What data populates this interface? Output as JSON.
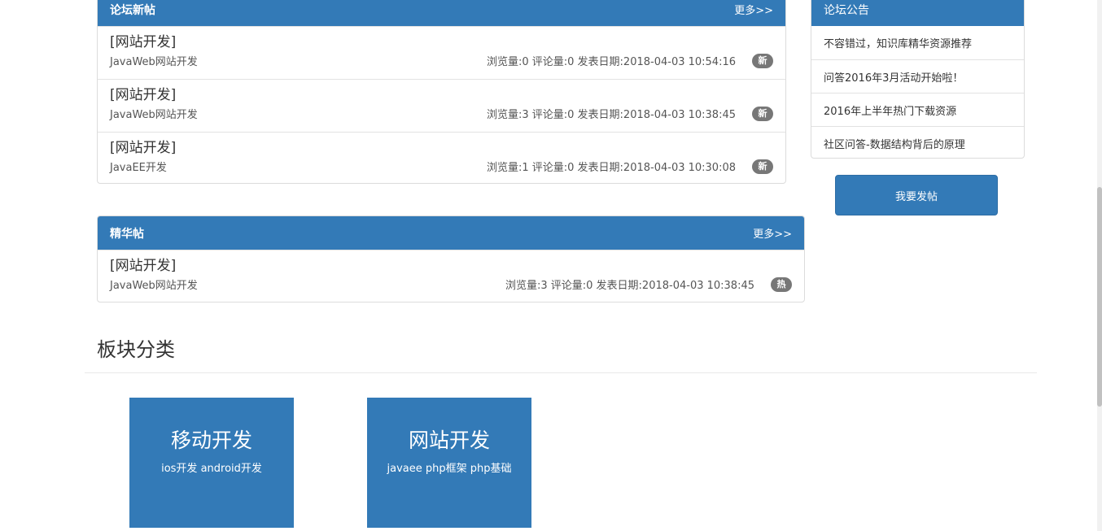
{
  "new_posts": {
    "title": "论坛新帖",
    "more": "更多>>",
    "items": [
      {
        "title": "[网站开发]",
        "category": "JavaWeb网站开发",
        "stats": "浏览量:0 评论量:0 发表日期:2018-04-03 10:54:16",
        "badge": "新"
      },
      {
        "title": "[网站开发]",
        "category": "JavaWeb网站开发",
        "stats": "浏览量:3 评论量:0 发表日期:2018-04-03 10:38:45",
        "badge": "新"
      },
      {
        "title": "[网站开发]",
        "category": "JavaEE开发",
        "stats": "浏览量:1 评论量:0 发表日期:2018-04-03 10:30:08",
        "badge": "新"
      }
    ]
  },
  "essence": {
    "title": "精华帖",
    "more": "更多>>",
    "items": [
      {
        "title": "[网站开发]",
        "category": "JavaWeb网站开发",
        "stats": "浏览量:3 评论量:0 发表日期:2018-04-03 10:38:45",
        "badge": "热"
      }
    ]
  },
  "notice": {
    "title": "论坛公告",
    "items": [
      "不容错过，知识库精华资源推荐",
      "问答2016年3月活动开始啦！",
      "2016年上半年热门下载资源",
      "社区问答-数据结构背后的原理"
    ]
  },
  "post_button": "我要发帖",
  "categories": {
    "title": "板块分类",
    "items": [
      {
        "name": "移动开发",
        "sub": "ios开发 android开发"
      },
      {
        "name": "网站开发",
        "sub": "javaee php框架 php基础"
      }
    ]
  },
  "colors": {
    "primary": "#337ab7",
    "badge": "#777777"
  }
}
